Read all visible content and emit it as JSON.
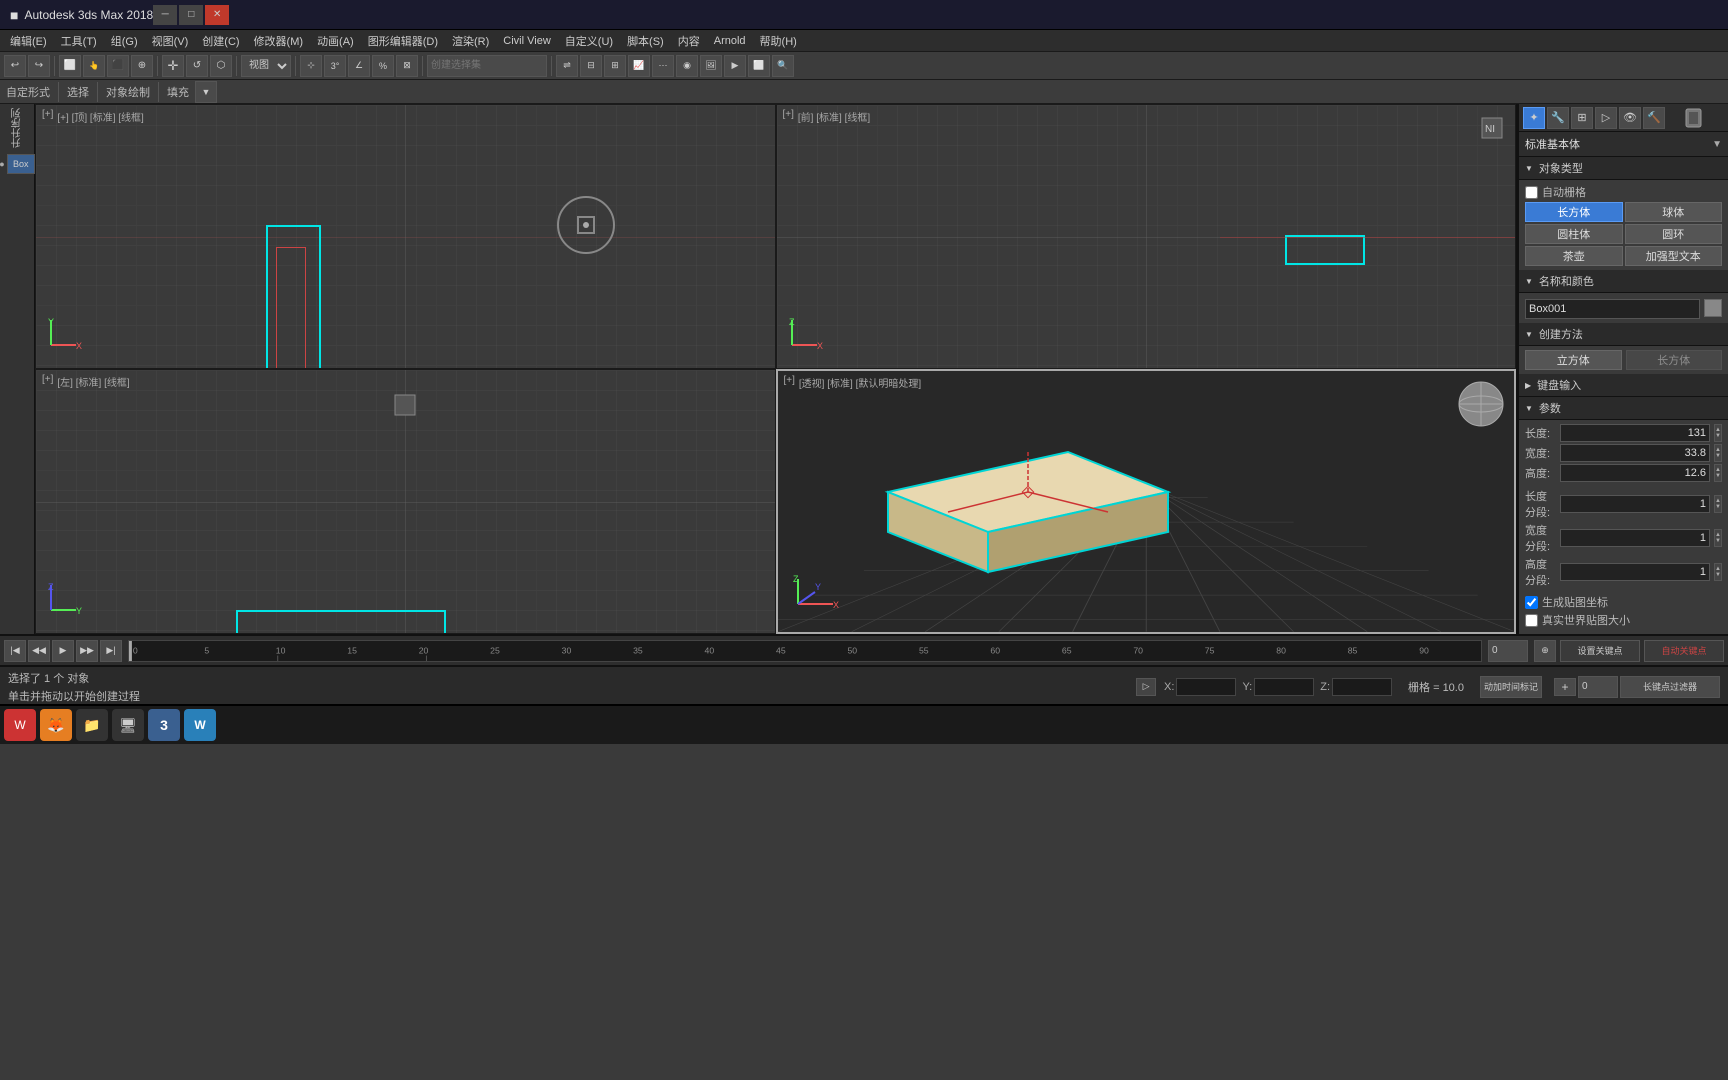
{
  "app": {
    "title": "Autodesk 3ds Max 2018",
    "icon": "■"
  },
  "menu": {
    "items": [
      "编辑(E)",
      "工具(T)",
      "组(G)",
      "视图(V)",
      "创建(C)",
      "修改器(M)",
      "动画(A)",
      "图形编辑器(D)",
      "渲染(R)",
      "Civil View",
      "自定义(U)",
      "脚本(S)",
      "内容",
      "Arnold",
      "帮助(H)"
    ]
  },
  "toolbar1": {
    "buttons": [
      "↩",
      "↪",
      "⬜",
      "⬜",
      "⬜",
      "⊕",
      "↺",
      "⬜",
      "视图",
      "⬜",
      "⬜",
      "⬜",
      "3°",
      "%",
      "%",
      "创建选择集"
    ]
  },
  "toolbar2": {
    "labels": [
      "自定形式",
      "选择",
      "对象绘制",
      "填充"
    ]
  },
  "viewports": {
    "topLeft": {
      "label": "[+] [顶] [标准] [线框]",
      "type": "top"
    },
    "topRight": {
      "label": "[+] [前] [标准] [线框]",
      "type": "front"
    },
    "bottomLeft": {
      "label": "[+] [左] [标准] [线框]",
      "type": "left"
    },
    "bottomRight": {
      "label": "[+] [透视] [标准] [默认明暗处理]",
      "type": "perspective"
    }
  },
  "right_panel": {
    "title": "标准基本体",
    "sections": {
      "object_type": {
        "label": "对象类型",
        "items": [
          "自动栅格",
          "长方体",
          "球体",
          "圆柱体",
          "圆环",
          "茶壶",
          "加强型文本"
        ]
      },
      "name_color": {
        "label": "名称和颜色",
        "value": "Box001"
      },
      "creation_method": {
        "label": "创建方法",
        "options": [
          "立方体"
        ]
      },
      "keyboard_input": {
        "label": "键盘输入"
      },
      "params": {
        "label": "参数",
        "length_label": "长度:",
        "length_value": "131",
        "width_label": "宽度:",
        "width_value": "33.8",
        "height_label": "高度:",
        "height_value": "12.6",
        "length_segs_label": "长度分段:",
        "length_segs_value": "1",
        "width_segs_label": "宽度分段:",
        "width_segs_value": "1",
        "height_segs_label": "高度分段:",
        "height_segs_value": "1"
      },
      "map_coords": {
        "generate_label": "生成贴图坐标",
        "real_world_label": "真实世界贴图大小"
      }
    }
  },
  "status": {
    "selected": "选择了 1 个 对象",
    "hint": "单击并拖动以开始创建过程",
    "x_label": "X:",
    "y_label": "Y:",
    "z_label": "Z:",
    "grid_label": "栅格 = 10.0",
    "add_key": "动加时间标记",
    "auto_key": "自动关键点",
    "set_key": "设置关键点",
    "filter": "长键点过滤器"
  },
  "timeline": {
    "current_frame": "0",
    "ticks": [
      "0",
      "5",
      "10",
      "15",
      "20",
      "25",
      "30",
      "35",
      "40",
      "45",
      "50",
      "55",
      "60",
      "65",
      "70",
      "75",
      "80",
      "85",
      "90"
    ]
  },
  "taskbar": {
    "icons": [
      "⊞",
      "🦊",
      "📁",
      "🖥",
      "3",
      "W"
    ]
  }
}
